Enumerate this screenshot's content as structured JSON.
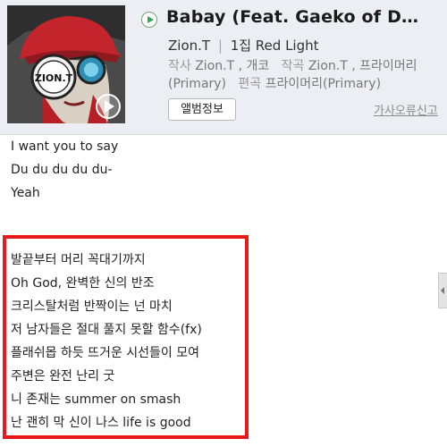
{
  "song": {
    "title": "Babay (Feat. Gaeko of D…",
    "artist": "Zion.T",
    "album": "1집 Red Light",
    "credits_text_1": "작사",
    "credits_value_1": "Zion.T , 개코",
    "credits_text_2": "작곡",
    "credits_value_2": "Zion.T , 프라이머리(Primary)",
    "credits_text_3": "편곡",
    "credits_value_3": "프라이머리(Primary)"
  },
  "album_art": {
    "label": "ZION.T"
  },
  "buttons": {
    "album_info": "앨범정보",
    "lyrics_error": "가사오류신고"
  },
  "lyrics": [
    "I want you to say",
    "Du du du du du-",
    "Yeah"
  ],
  "highlighted_lyrics": [
    "발끝부터 머리 꼭대기까지",
    "Oh God, 완벽한 신의 반조",
    "크리스탈처럼 반짝이는 넌 마치",
    "저 남자들은 절대 풀지 못할 함수(fx)",
    "플래쉬몹 하듯 뜨거운 시선들이 모여",
    "주변은 완전 난리 굿",
    "니 존재는 summer on smash",
    "난 괜히 막 신이 나스 life is good"
  ],
  "colors": {
    "highlight_border": "#e8181b",
    "play_icon": "#2fa84f",
    "header_bg": "#eceef3"
  }
}
